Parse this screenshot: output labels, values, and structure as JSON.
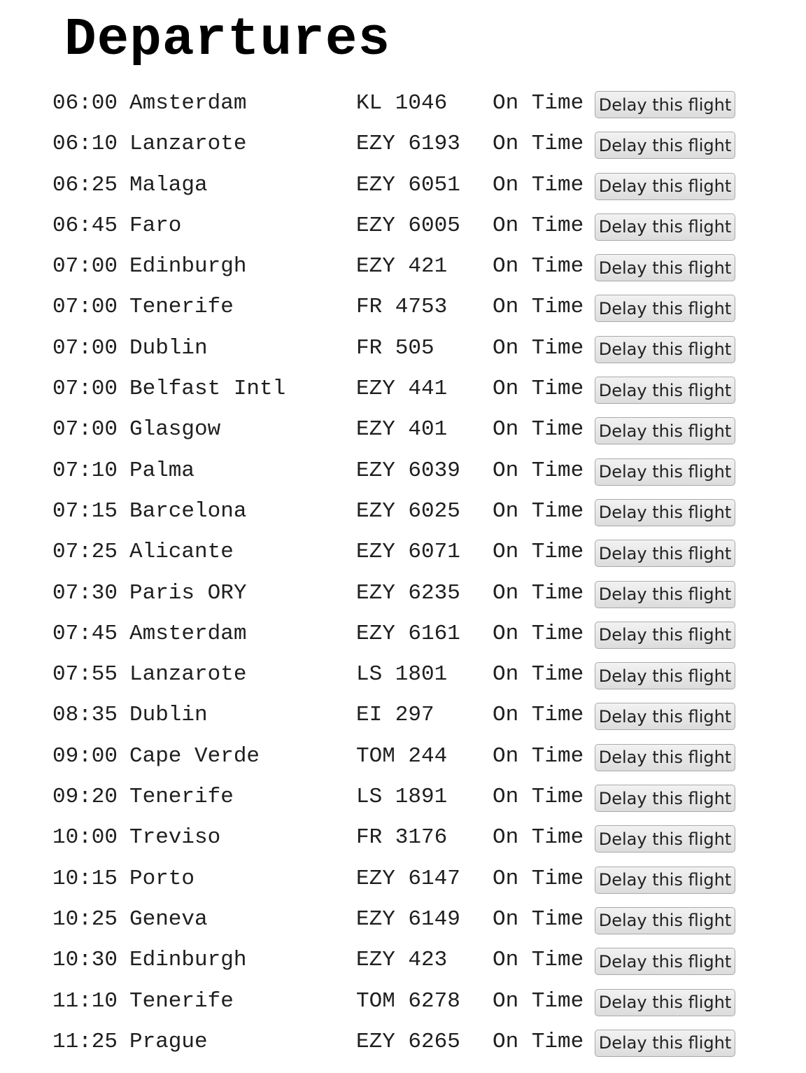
{
  "page": {
    "title": "Departures",
    "button_label": "Delay this flight"
  },
  "flights": [
    {
      "time": "06:00",
      "destination": "Amsterdam",
      "flight": "KL 1046",
      "status": "On Time"
    },
    {
      "time": "06:10",
      "destination": "Lanzarote",
      "flight": "EZY 6193",
      "status": "On Time"
    },
    {
      "time": "06:25",
      "destination": "Malaga",
      "flight": "EZY 6051",
      "status": "On Time"
    },
    {
      "time": "06:45",
      "destination": "Faro",
      "flight": "EZY 6005",
      "status": "On Time"
    },
    {
      "time": "07:00",
      "destination": "Edinburgh",
      "flight": "EZY 421",
      "status": "On Time"
    },
    {
      "time": "07:00",
      "destination": "Tenerife",
      "flight": "FR 4753",
      "status": "On Time"
    },
    {
      "time": "07:00",
      "destination": "Dublin",
      "flight": "FR 505",
      "status": "On Time"
    },
    {
      "time": "07:00",
      "destination": "Belfast Intl",
      "flight": "EZY 441",
      "status": "On Time"
    },
    {
      "time": "07:00",
      "destination": "Glasgow",
      "flight": "EZY 401",
      "status": "On Time"
    },
    {
      "time": "07:10",
      "destination": "Palma",
      "flight": "EZY 6039",
      "status": "On Time"
    },
    {
      "time": "07:15",
      "destination": "Barcelona",
      "flight": "EZY 6025",
      "status": "On Time"
    },
    {
      "time": "07:25",
      "destination": "Alicante",
      "flight": "EZY 6071",
      "status": "On Time"
    },
    {
      "time": "07:30",
      "destination": "Paris ORY",
      "flight": "EZY 6235",
      "status": "On Time"
    },
    {
      "time": "07:45",
      "destination": "Amsterdam",
      "flight": "EZY 6161",
      "status": "On Time"
    },
    {
      "time": "07:55",
      "destination": "Lanzarote",
      "flight": "LS 1801",
      "status": "On Time"
    },
    {
      "time": "08:35",
      "destination": "Dublin",
      "flight": "EI 297",
      "status": "On Time"
    },
    {
      "time": "09:00",
      "destination": "Cape Verde",
      "flight": "TOM 244",
      "status": "On Time"
    },
    {
      "time": "09:20",
      "destination": "Tenerife",
      "flight": "LS 1891",
      "status": "On Time"
    },
    {
      "time": "10:00",
      "destination": "Treviso",
      "flight": "FR 3176",
      "status": "On Time"
    },
    {
      "time": "10:15",
      "destination": "Porto",
      "flight": "EZY 6147",
      "status": "On Time"
    },
    {
      "time": "10:25",
      "destination": "Geneva",
      "flight": "EZY 6149",
      "status": "On Time"
    },
    {
      "time": "10:30",
      "destination": "Edinburgh",
      "flight": "EZY 423",
      "status": "On Time"
    },
    {
      "time": "11:10",
      "destination": "Tenerife",
      "flight": "TOM 6278",
      "status": "On Time"
    },
    {
      "time": "11:25",
      "destination": "Prague",
      "flight": "EZY 6265",
      "status": "On Time"
    }
  ]
}
